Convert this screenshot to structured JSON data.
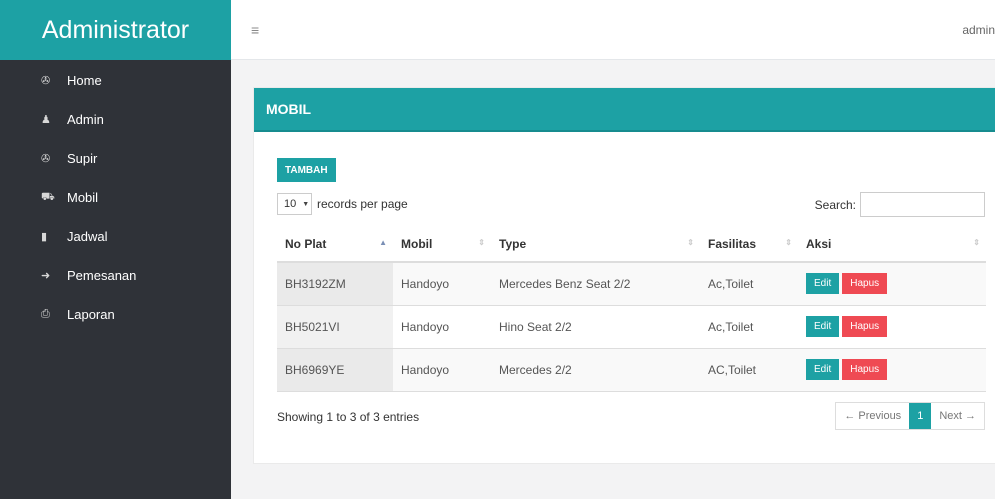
{
  "brand": "Administrator",
  "topbar": {
    "menu_icon": "≡",
    "user": "admin"
  },
  "sidebar": {
    "items": [
      {
        "icon": "dashboard-icon",
        "glyph": "✇",
        "label": "Home"
      },
      {
        "icon": "user-icon",
        "glyph": "♟",
        "label": "Admin"
      },
      {
        "icon": "dashboard-icon",
        "glyph": "✇",
        "label": "Supir"
      },
      {
        "icon": "car-icon",
        "glyph": "⛟",
        "label": "Mobil"
      },
      {
        "icon": "book-icon",
        "glyph": "▮",
        "label": "Jadwal"
      },
      {
        "icon": "sign-in-icon",
        "glyph": "➜",
        "label": "Pemesanan"
      },
      {
        "icon": "print-icon",
        "glyph": "⎙",
        "label": "Laporan"
      }
    ]
  },
  "panel": {
    "title": "MOBIL",
    "add_label": "TAMBAH",
    "length_value": "10",
    "length_suffix": "records per page",
    "search_label": "Search:",
    "search_value": "",
    "columns": [
      "No Plat",
      "Mobil",
      "Type",
      "Fasilitas",
      "Aksi"
    ],
    "rows": [
      {
        "plat": "BH3192ZM",
        "mobil": "Handoyo",
        "type": "Mercedes Benz Seat 2/2",
        "fasilitas": "Ac,Toilet",
        "edit": "Edit",
        "hapus": "Hapus"
      },
      {
        "plat": "BH5021VI",
        "mobil": "Handoyo",
        "type": "Hino Seat 2/2",
        "fasilitas": "Ac,Toilet",
        "edit": "Edit",
        "hapus": "Hapus"
      },
      {
        "plat": "BH6969YE",
        "mobil": "Handoyo",
        "type": "Mercedes 2/2",
        "fasilitas": "AC,Toilet",
        "edit": "Edit",
        "hapus": "Hapus"
      }
    ],
    "info": "Showing 1 to 3 of 3 entries",
    "pager": {
      "prev": "← Previous",
      "current": "1",
      "next": "Next →"
    }
  },
  "colors": {
    "accent": "#1da1a4",
    "danger": "#ef4a53",
    "sidebar": "#2f3238"
  }
}
